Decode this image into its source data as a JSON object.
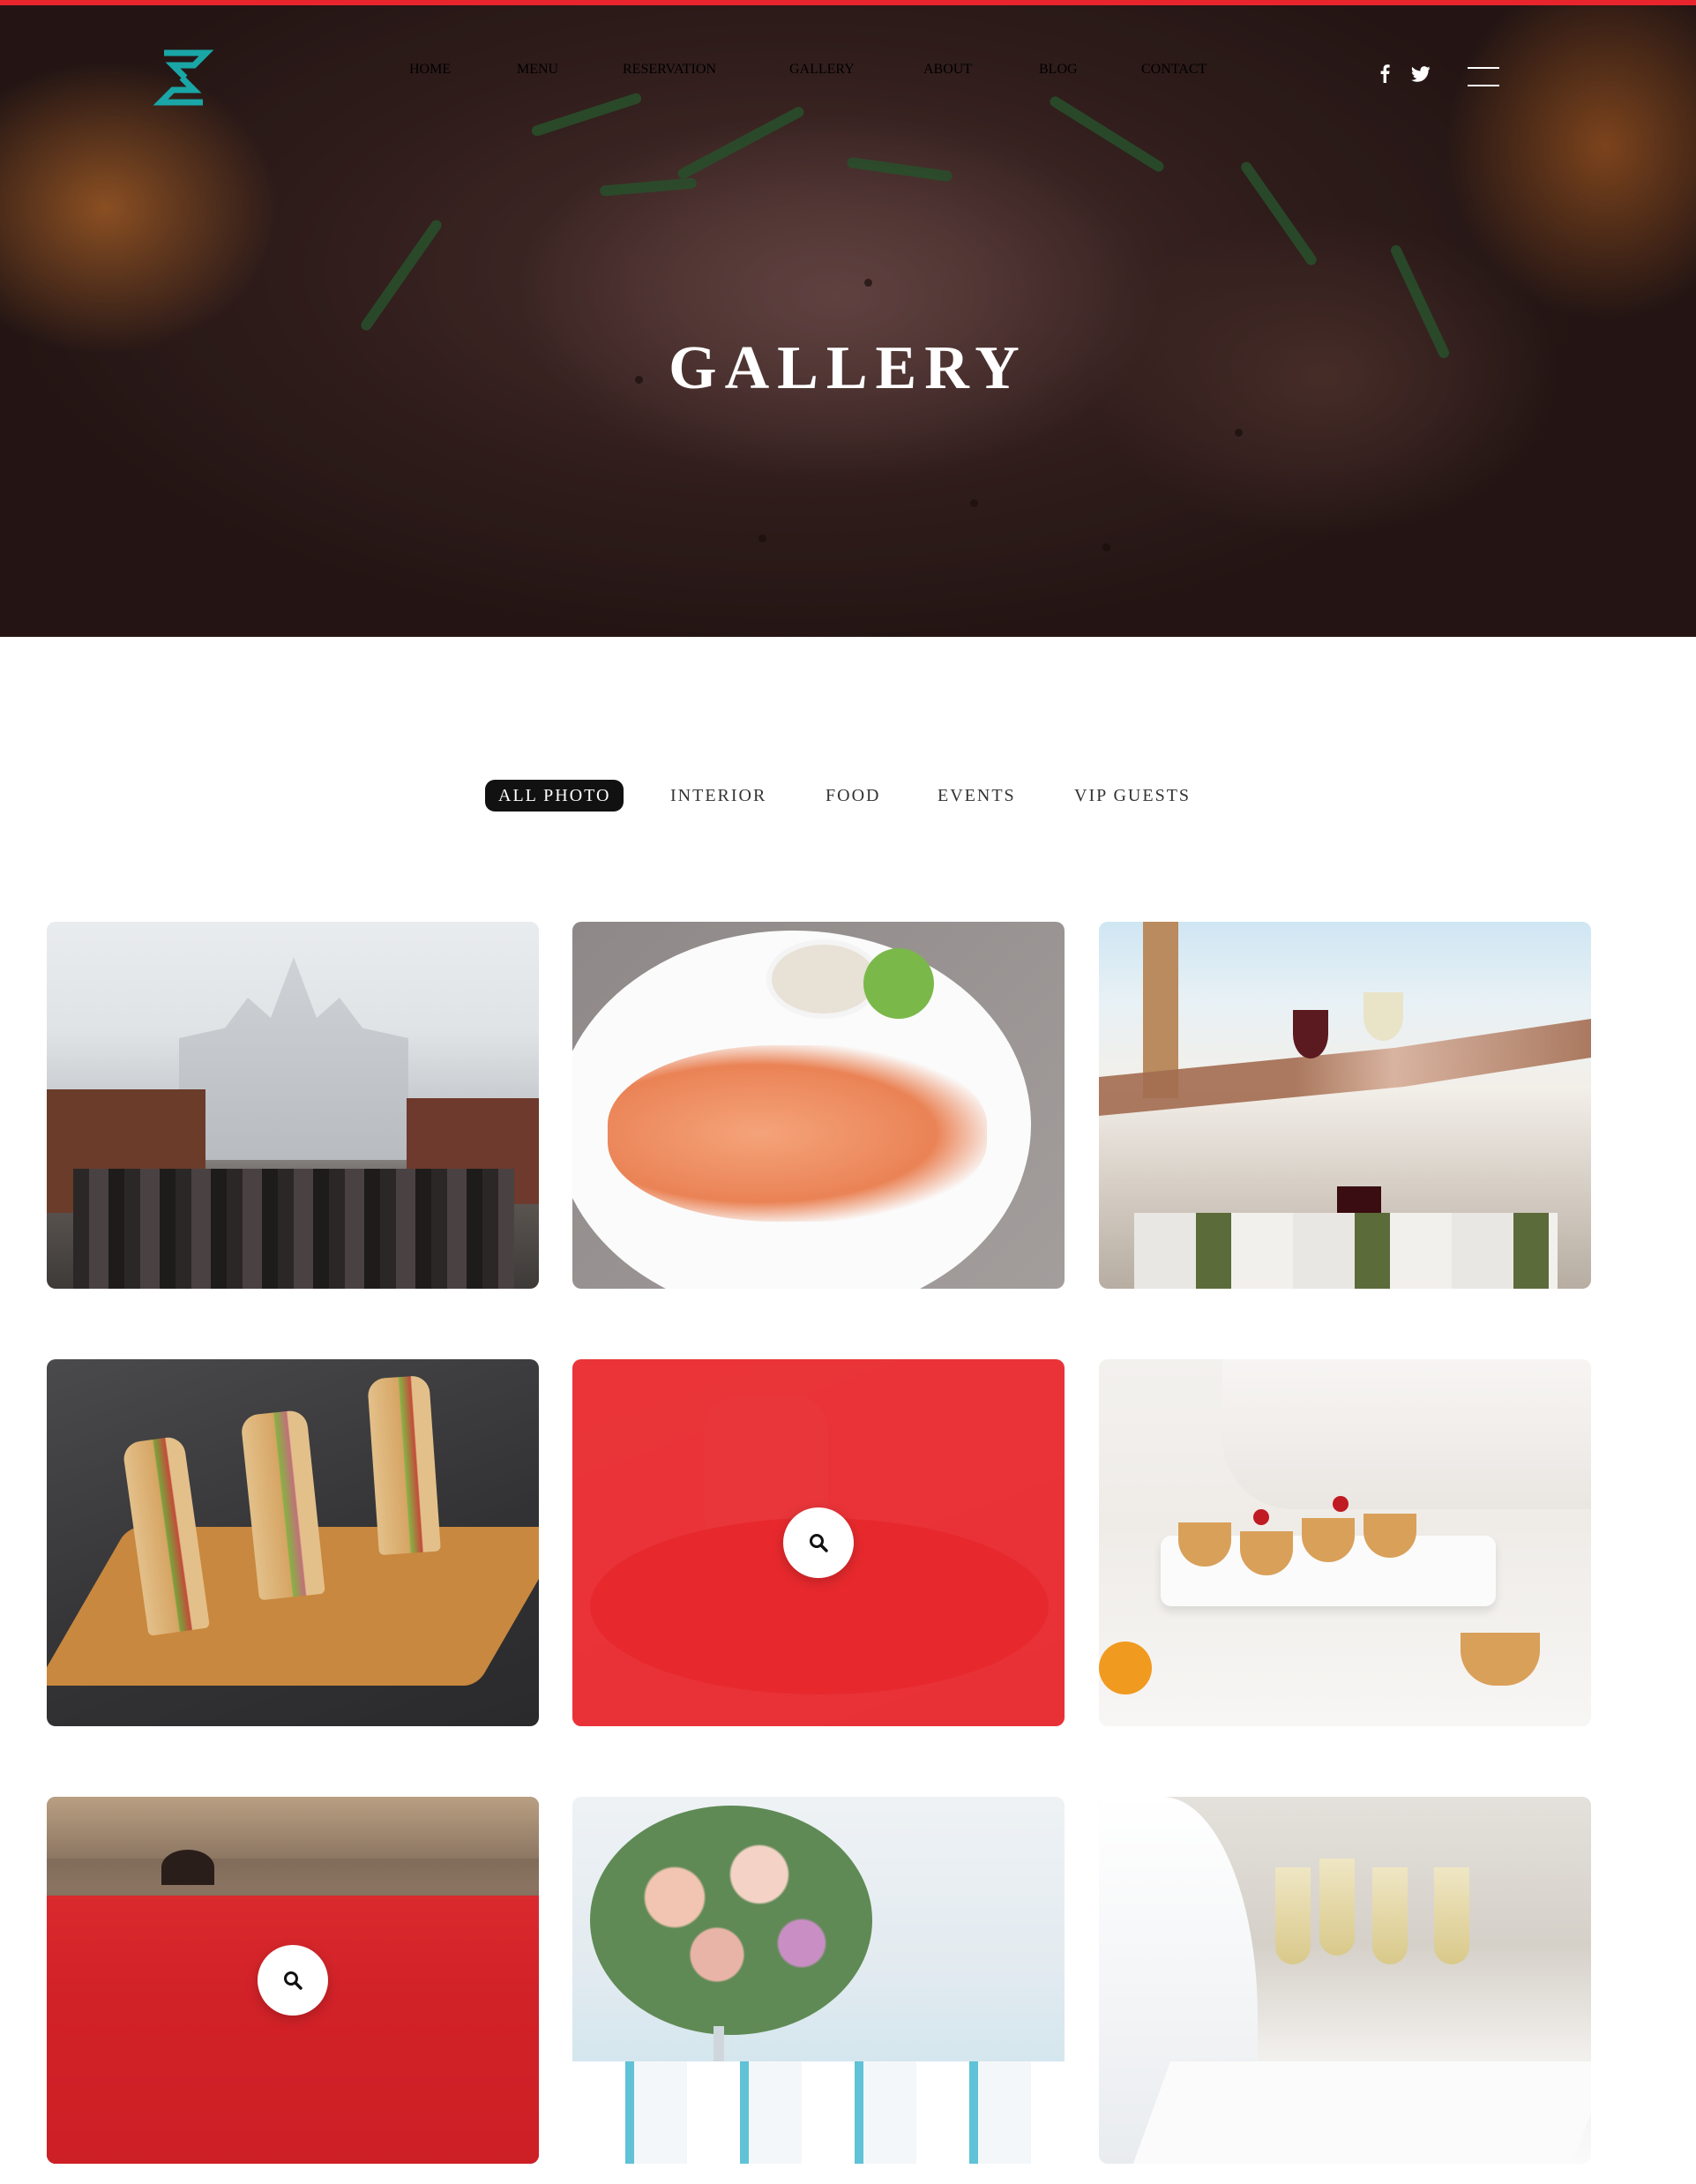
{
  "header": {
    "nav": [
      "HOME",
      "MENU",
      "RESERVATION",
      "GALLERY",
      "ABOUT",
      "BLOG",
      "CONTACT"
    ],
    "social": [
      "facebook-icon",
      "twitter-icon"
    ],
    "menu_icon": "hamburger-menu-icon",
    "logo_color": "#1aa6a6"
  },
  "hero": {
    "title": "GALLERY"
  },
  "filters": {
    "items": [
      "ALL PHOTO",
      "INTERIOR",
      "FOOD",
      "EVENTS",
      "VIP GUESTS"
    ],
    "active": "ALL PHOTO"
  },
  "gallery": {
    "items": [
      {
        "subject": "christmas market",
        "hover": false
      },
      {
        "subject": "grilled shrimp",
        "hover": false
      },
      {
        "subject": "wine toast",
        "hover": false
      },
      {
        "subject": "sandwiches",
        "hover": false
      },
      {
        "subject": "dish",
        "hover": true
      },
      {
        "subject": "desserts",
        "hover": false
      },
      {
        "subject": "kitchen",
        "hover": true
      },
      {
        "subject": "flower arrangement",
        "hover": false
      },
      {
        "subject": "champagne glasses",
        "hover": false
      }
    ],
    "zoom_icon": "search-icon"
  },
  "colors": {
    "accent": "#e8252d",
    "overlay": "#e81e26",
    "active_filter": "#111111"
  }
}
